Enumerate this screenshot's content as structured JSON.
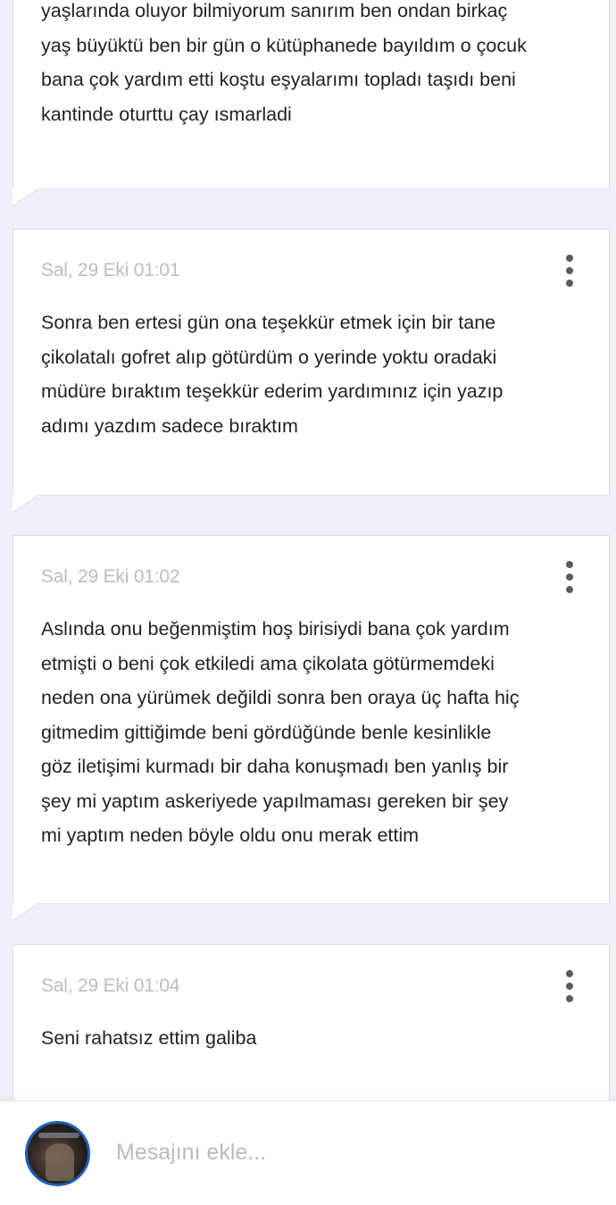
{
  "messages": [
    {
      "time": "",
      "lines": [
        "yaşlarında oluyor bilmiyorum sanırım ben ondan birkaç",
        "yaş büyüktü ben bir gün o kütüphanede bayıldım o çocuk",
        "bana çok yardım etti koştu eşyalarımı topladı taşıdı beni",
        "kantinde oturttu çay ısmarladi"
      ]
    },
    {
      "time": "Sal, 29 Eki 01:01",
      "lines": [
        "Sonra ben ertesi gün ona teşekkür etmek için bir tane",
        "çikolatalı gofret alıp götürdüm o yerinde yoktu oradaki",
        "müdüre bıraktım teşekkür ederim yardımınız için yazıp",
        "adımı yazdım sadece bıraktım"
      ]
    },
    {
      "time": "Sal, 29 Eki 01:02",
      "lines": [
        "Aslında onu beğenmiştim hoş birisiydi bana çok yardım",
        "etmişti o beni çok etkiledi ama çikolata götürmemdeki",
        "neden ona yürümek değildi sonra ben oraya üç hafta hiç",
        "gitmedim gittiğimde beni gördüğünde benle kesinlikle",
        "göz iletişimi kurmadı bir daha konuşmadı ben yanlış bir",
        "şey mi yaptım askeriyede yapılmaması gereken bir şey",
        "mi yaptım neden böyle oldu onu merak ettim"
      ]
    },
    {
      "time": "Sal, 29 Eki 01:04",
      "lines": [
        "Seni rahatsız ettim galiba"
      ]
    }
  ],
  "composer": {
    "placeholder": "Mesajını ekle...",
    "avatar_icon": "user-avatar-photo"
  },
  "menu_icon": "more-vertical-icon",
  "colors": {
    "background": "#f0f1f8",
    "card": "#ffffff",
    "timestamp": "#b9bcc6",
    "text": "#1f2127",
    "avatar_ring": "#1f5fb8"
  }
}
